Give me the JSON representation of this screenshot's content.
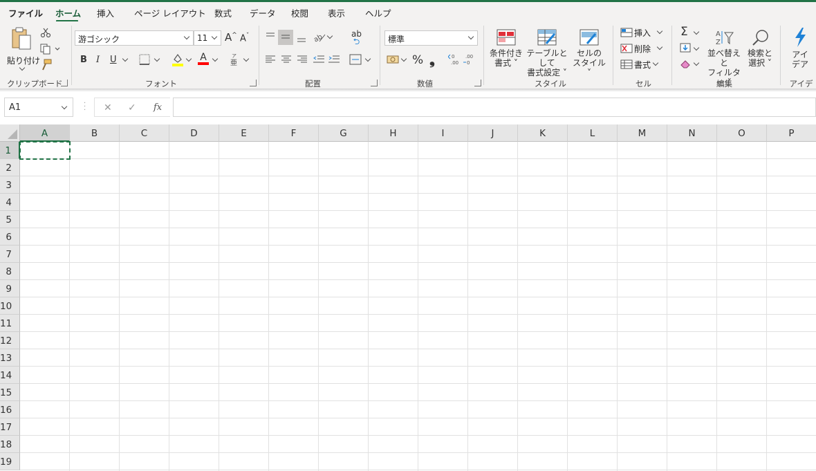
{
  "tabs": [
    "ファイル",
    "ホーム",
    "挿入",
    "ページ レイアウト",
    "数式",
    "データ",
    "校閲",
    "表示",
    "ヘルプ"
  ],
  "ribbon": {
    "clipboard": {
      "group": "クリップボード",
      "paste": "貼り付け"
    },
    "font": {
      "group": "フォント",
      "font_name": "游ゴシック",
      "font_size": "11",
      "bold": "B",
      "italic": "I",
      "underline": "U",
      "grow": "A",
      "shrink": "A",
      "text_color": "A"
    },
    "alignment": {
      "group": "配置",
      "wrap": "ab"
    },
    "number": {
      "group": "数値",
      "format": "標準",
      "percent": "%",
      "comma": "❟",
      "inc_decimal": "←0 .00",
      "dec_decimal": ".00 →0"
    },
    "styles": {
      "group": "スタイル",
      "conditional": [
        "条件付き",
        "書式"
      ],
      "table": [
        "テーブルとして",
        "書式設定"
      ],
      "cell_styles": [
        "セルの",
        "スタイル"
      ]
    },
    "cells": {
      "group": "セル",
      "insert": "挿入",
      "delete": "削除",
      "format": "書式"
    },
    "editing": {
      "group": "編集",
      "sort": [
        "並べ替えと",
        "フィルター"
      ],
      "find": [
        "検索と",
        "選択"
      ]
    },
    "ideas": {
      "group": "アイデア",
      "label": [
        "アイ",
        "デア"
      ]
    }
  },
  "formula_bar": {
    "name_box": "A1",
    "cancel": "✕",
    "enter": "✓",
    "fx": "fx",
    "value": ""
  },
  "columns": [
    "A",
    "B",
    "C",
    "D",
    "E",
    "F",
    "G",
    "H",
    "I",
    "J",
    "K",
    "L",
    "M",
    "N",
    "O",
    "P"
  ],
  "rows": [
    "1",
    "2",
    "3",
    "4",
    "5",
    "6",
    "7",
    "8",
    "9",
    "10",
    "11",
    "12",
    "13",
    "14",
    "15",
    "16",
    "17",
    "18",
    "19"
  ],
  "selected_cell": "A1",
  "colors": {
    "accent": "#217346",
    "ribbon_bg": "#f3f2f1",
    "highlight_yellow": "#ffff00",
    "font_red": "#ff0000",
    "ideas_blue": "#1f82d6"
  }
}
